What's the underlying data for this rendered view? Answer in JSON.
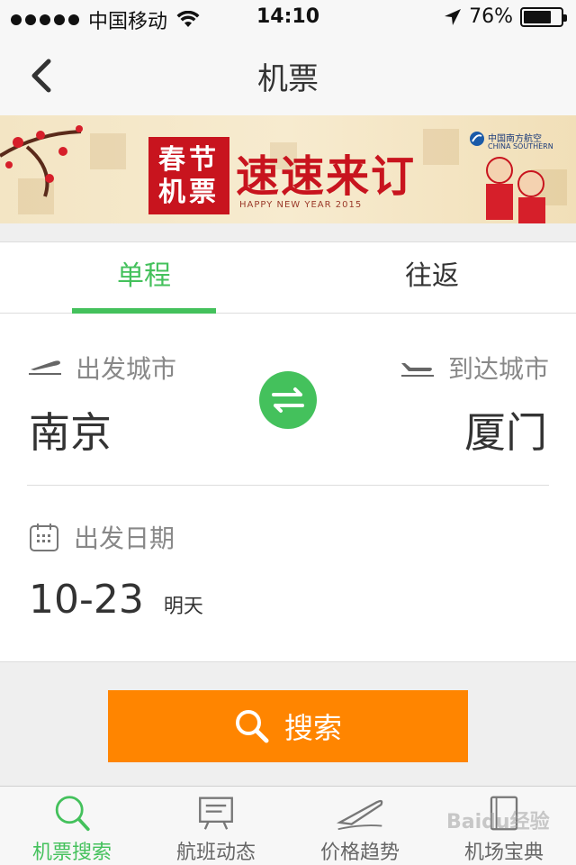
{
  "status_bar": {
    "carrier": "中国移动",
    "time": "14:10",
    "battery_percent": "76%",
    "battery_level": 0.76,
    "icons": [
      "signal-dots-icon",
      "wifi-icon",
      "location-arrow-icon",
      "battery-icon"
    ]
  },
  "navbar": {
    "title": "机票",
    "back_icon": "chevron-left-icon"
  },
  "banner": {
    "badge_text": "春节机票",
    "headline": "速速来订",
    "subtitle": "HAPPY NEW YEAR 2015",
    "airline_cn": "中国南方航空",
    "airline_en": "CHINA SOUTHERN"
  },
  "trip_tabs": [
    {
      "label": "单程",
      "active": true
    },
    {
      "label": "往返",
      "active": false
    }
  ],
  "form": {
    "from_label": "出发城市",
    "from_city": "南京",
    "to_label": "到达城市",
    "to_city": "厦门",
    "swap_icon": "swap-arrows-icon",
    "date_label": "出发日期",
    "date_value": "10-23",
    "date_relative": "明天"
  },
  "search_button": {
    "label": "搜索",
    "icon": "search-icon"
  },
  "bottom_tabs": [
    {
      "label": "机票搜索",
      "icon": "search-icon",
      "active": true
    },
    {
      "label": "航班动态",
      "icon": "board-icon",
      "active": false
    },
    {
      "label": "价格趋势",
      "icon": "plane-trend-icon",
      "active": false
    },
    {
      "label": "机场宝典",
      "icon": "book-icon",
      "active": false
    }
  ],
  "watermark": "Baidu经验",
  "colors": {
    "accent_green": "#44c15c",
    "search_orange": "#ff8500",
    "banner_red": "#c8141e"
  }
}
